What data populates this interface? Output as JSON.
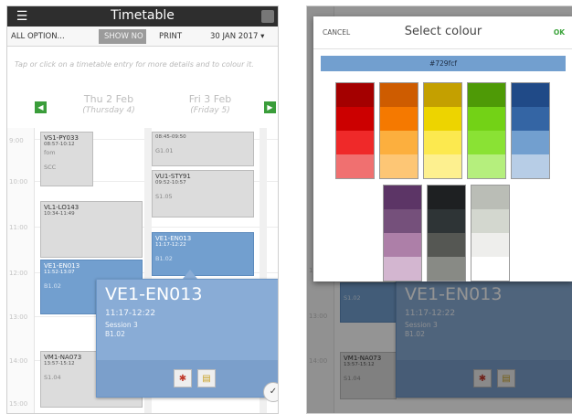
{
  "colors": {
    "accent_blue": "#729fcf",
    "topbar": "#2e2e2e",
    "nav_green": "#3a9d3a",
    "event_grey": "#dcdcdc"
  },
  "timetable": {
    "title": "Timetable",
    "toolbar": {
      "all_options": "ALL OPTION...",
      "show_button": "SHOW NO",
      "print": "PRINT",
      "date": "30 JAN 2017 ▾"
    },
    "hint": "Tap or click on a timetable entry for more details and to colour it.",
    "days": [
      {
        "name": "Thu 2 Feb",
        "sub": "(Thursday 4)"
      },
      {
        "name": "Fri 3 Feb",
        "sub": "(Friday 5)"
      }
    ],
    "times": [
      "9:00",
      "10:00",
      "11:00",
      "12:00",
      "13:00",
      "14:00",
      "15:00"
    ],
    "events": [
      {
        "code": "VS1-PY033",
        "time": "08:57-10:12",
        "room": "fom"
      },
      {
        "code": "",
        "time": "",
        "room": "SCC"
      },
      {
        "code": "",
        "time": "08:45-09:50",
        "room": "G1.01"
      },
      {
        "code": "VU1-STY91",
        "time": "09:52-10:57",
        "room": "S1.05"
      },
      {
        "code": "VL1-LO143",
        "time": "10:34-11:49",
        "room": ""
      },
      {
        "code": "VE1-EN013",
        "time": "11:17-12:22",
        "room": "B1.02"
      },
      {
        "code": "VE1-EN013",
        "time": "11:52-13:07",
        "room": "B1.02"
      },
      {
        "code": "VM1-NA073",
        "time": "13:57-15:12",
        "room": "S1.04"
      }
    ],
    "popup": {
      "code": "VE1-EN013",
      "time": "11:17-12:22",
      "session": "Session 3",
      "room": "B1.02"
    }
  },
  "colour_picker": {
    "cancel": "CANCEL",
    "title": "Select colour",
    "ok": "OK",
    "hex": "#729fcf",
    "palette_row1": [
      [
        "#a40000",
        "#cc0000",
        "#ef2929",
        "#f07070"
      ],
      [
        "#ce5c00",
        "#f57900",
        "#fcaf3e",
        "#fdc675"
      ],
      [
        "#c4a000",
        "#edd400",
        "#fce94f",
        "#fdf08f"
      ],
      [
        "#4e9a06",
        "#73d216",
        "#8ae234",
        "#b5ef7d"
      ],
      [
        "#204a87",
        "#3465a4",
        "#729fcf",
        "#b7cde6"
      ]
    ],
    "palette_row2": [
      [
        "#5c3566",
        "#75507b",
        "#ad7fa8",
        "#d3b6d0"
      ],
      [
        "#1e2022",
        "#2e3436",
        "#555753",
        "#888a85"
      ],
      [
        "#babdb6",
        "#d3d7cf",
        "#eeeeec",
        "#ffffff"
      ]
    ]
  },
  "background_popup": {
    "code": "VE1-EN013",
    "time": "11:17-12:22",
    "session": "Session 3",
    "room": "B1.02",
    "row_room": "S1.02",
    "lower_code": "VM1-NA073",
    "lower_time": "13:57-15:12",
    "lower_room": "S1.04",
    "times": [
      "12:00",
      "13:00",
      "14:00"
    ]
  }
}
